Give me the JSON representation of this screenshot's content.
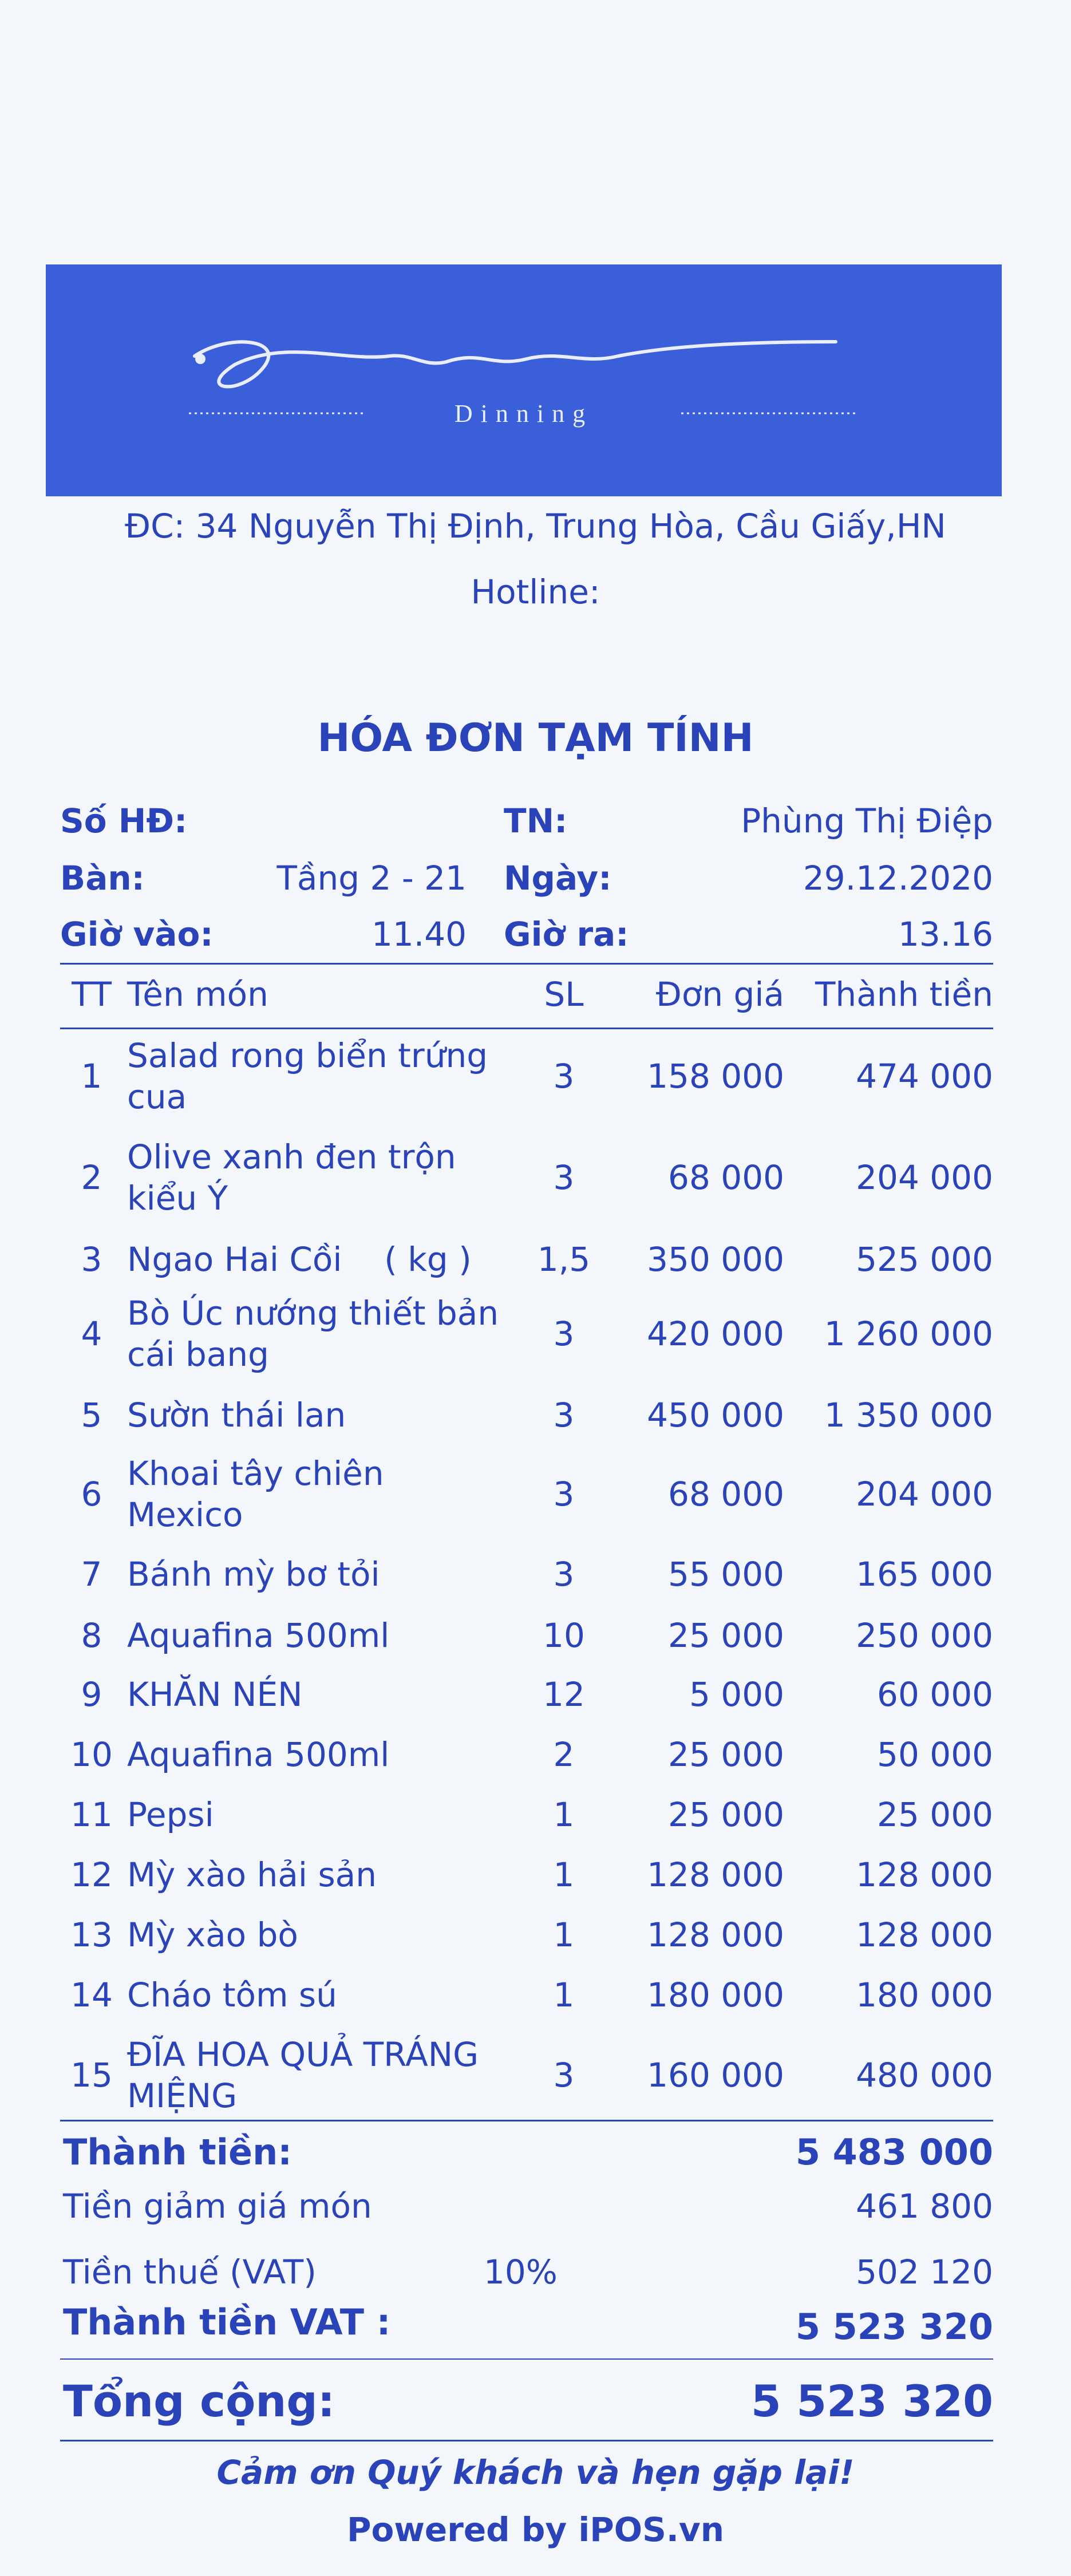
{
  "header": {
    "logo_script_text": "Lino",
    "logo_sub_text": "Dinning",
    "address": "ĐC: 34 Nguyễn Thị Định, Trung Hòa, Cầu Giấy,HN",
    "hotline": "Hotline:"
  },
  "title": "HÓA ĐƠN TẠM TÍNH",
  "info": {
    "so_hd_label": "Số HĐ:",
    "so_hd_value": "",
    "tn_label": "TN:",
    "tn_value": "Phùng Thị Điệp",
    "ban_label": "Bàn:",
    "ban_value": "Tầng 2 - 21",
    "ngay_label": "Ngày:",
    "ngay_value": "29.12.2020",
    "gio_vao_label": "Giờ vào:",
    "gio_vao_value": "11.40",
    "gio_ra_label": "Giờ ra:",
    "gio_ra_value": "13.16"
  },
  "columns": {
    "tt": "TT",
    "name": "Tên món",
    "sl": "SL",
    "don_gia": "Đơn giá",
    "thanh_tien": "Thành tiền"
  },
  "items": [
    {
      "tt": "1",
      "name": "Salad rong biển trứng cua",
      "sl": "3",
      "don_gia": "158 000",
      "thanh_tien": "474 000"
    },
    {
      "tt": "2",
      "name": "Olive xanh đen trộn kiểu Ý",
      "sl": "3",
      "don_gia": "68 000",
      "thanh_tien": "204 000"
    },
    {
      "tt": "3",
      "name": "Ngao Hai Cồi    ( kg )",
      "sl": "1,5",
      "don_gia": "350 000",
      "thanh_tien": "525 000"
    },
    {
      "tt": "4",
      "name": "Bò Úc nướng thiết bản cái bang",
      "sl": "3",
      "don_gia": "420 000",
      "thanh_tien": "1 260 000"
    },
    {
      "tt": "5",
      "name": "Sườn thái lan",
      "sl": "3",
      "don_gia": "450 000",
      "thanh_tien": "1 350 000"
    },
    {
      "tt": "6",
      "name": "Khoai tây chiên Mexico",
      "sl": "3",
      "don_gia": "68 000",
      "thanh_tien": "204 000"
    },
    {
      "tt": "7",
      "name": "Bánh mỳ bơ tỏi",
      "sl": "3",
      "don_gia": "55 000",
      "thanh_tien": "165 000"
    },
    {
      "tt": "8",
      "name": "Aquafina 500ml",
      "sl": "10",
      "don_gia": "25 000",
      "thanh_tien": "250 000"
    },
    {
      "tt": "9",
      "name": "KHĂN NÉN",
      "sl": "12",
      "don_gia": "5 000",
      "thanh_tien": "60 000"
    },
    {
      "tt": "10",
      "name": "Aquafina 500ml",
      "sl": "2",
      "don_gia": "25 000",
      "thanh_tien": "50 000"
    },
    {
      "tt": "11",
      "name": "Pepsi",
      "sl": "1",
      "don_gia": "25 000",
      "thanh_tien": "25 000"
    },
    {
      "tt": "12",
      "name": "Mỳ xào hải sản",
      "sl": "1",
      "don_gia": "128 000",
      "thanh_tien": "128 000"
    },
    {
      "tt": "13",
      "name": "Mỳ xào bò",
      "sl": "1",
      "don_gia": "128 000",
      "thanh_tien": "128 000"
    },
    {
      "tt": "14",
      "name": "Cháo tôm sú",
      "sl": "1",
      "don_gia": "180 000",
      "thanh_tien": "180 000"
    },
    {
      "tt": "15",
      "name": "ĐĨA HOA QUẢ TRÁNG MIỆNG",
      "sl": "3",
      "don_gia": "160 000",
      "thanh_tien": "480 000"
    }
  ],
  "summary": {
    "thanh_tien_label": "Thành tiền:",
    "thanh_tien_value": "5 483 000",
    "giam_gia_label": "Tiền giảm giá món",
    "giam_gia_value": "461 800",
    "thue_label": "Tiền thuế (VAT)",
    "thue_rate": "10%",
    "thue_value": "502 120",
    "thanh_tien_vat_label": "Thành tiền VAT :",
    "thanh_tien_vat_value": "5 523 320",
    "tong_cong_label": "Tổng cộng:",
    "tong_cong_value": "5 523 320"
  },
  "footer": {
    "thanks": "Cảm ơn Quý khách và hẹn gặp lại!",
    "powered": "Powered by iPOS.vn"
  },
  "colors": {
    "ink": "#2a43b8",
    "logo_band": "#3a5fd8",
    "paper": "#f3f6fb"
  }
}
